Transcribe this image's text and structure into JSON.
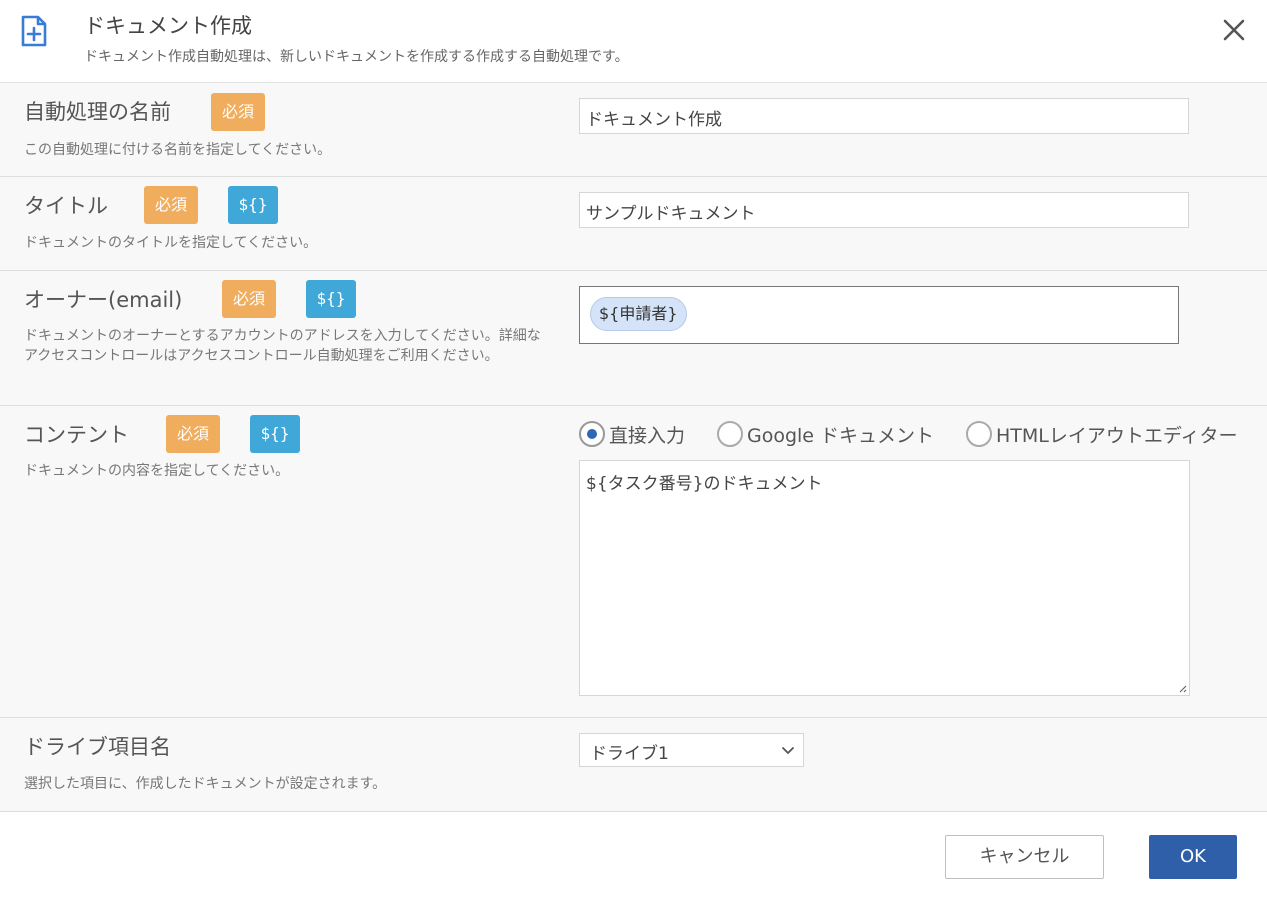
{
  "header": {
    "title": "ドキュメント作成",
    "subtitle": "ドキュメント作成自動処理は、新しいドキュメントを作成する作成する自動処理です。",
    "icon": "document-add-icon",
    "accent_color": "#3a7bd5"
  },
  "badges": {
    "required": "必須",
    "variable": "${}"
  },
  "fields": {
    "name": {
      "label": "自動処理の名前",
      "description": "この自動処理に付ける名前を指定してください。",
      "value": "ドキュメント作成"
    },
    "title": {
      "label": "タイトル",
      "description": "ドキュメントのタイトルを指定してください。",
      "value": "サンプルドキュメント"
    },
    "owner": {
      "label": "オーナー(email)",
      "description": "ドキュメントのオーナーとするアカウントのアドレスを入力してください。詳細なアクセスコントロールはアクセスコントロール自動処理をご利用ください。",
      "chip": "${申請者}"
    },
    "content": {
      "label": "コンテント",
      "description": "ドキュメントの内容を指定してください。",
      "options": [
        "直接入力",
        "Google ドキュメント",
        "HTMLレイアウトエディター"
      ],
      "selected": "直接入力",
      "value": "${タスク番号}のドキュメント"
    },
    "drive": {
      "label": "ドライブ項目名",
      "description": "選択した項目に、作成したドキュメントが設定されます。",
      "selected": "ドライブ1"
    }
  },
  "footer": {
    "cancel_label": "キャンセル",
    "ok_label": "OK"
  },
  "colors": {
    "required_badge": "#f0ad5e",
    "variable_badge": "#3fa8d8",
    "primary_button": "#2f5fa8",
    "row_background": "#f8f8f8"
  }
}
